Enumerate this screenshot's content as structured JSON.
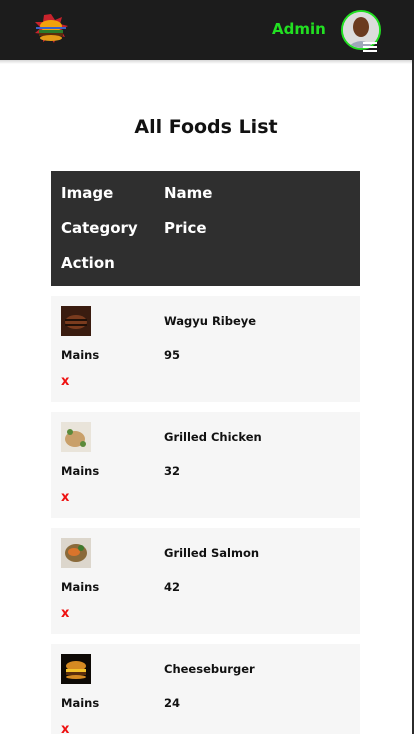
{
  "header": {
    "logo_icon": "burger-logo-icon",
    "admin_label": "Admin",
    "avatar_icon": "user-avatar-icon",
    "menu_icon": "hamburger-menu-icon",
    "accent_color": "#22e022"
  },
  "page": {
    "title": "All Foods List"
  },
  "table": {
    "columns": [
      "Image",
      "Name",
      "Category",
      "Price",
      "Action"
    ],
    "rows": [
      {
        "image_icon": "steak-thumbnail",
        "name": "Wagyu Ribeye",
        "category": "Mains",
        "price": "95",
        "action": "x"
      },
      {
        "image_icon": "chicken-thumbnail",
        "name": "Grilled Chicken",
        "category": "Mains",
        "price": "32",
        "action": "x"
      },
      {
        "image_icon": "salmon-thumbnail",
        "name": "Grilled Salmon",
        "category": "Mains",
        "price": "42",
        "action": "x"
      },
      {
        "image_icon": "burger-thumbnail",
        "name": "Cheeseburger",
        "category": "Mains",
        "price": "24",
        "action": "x"
      }
    ]
  }
}
